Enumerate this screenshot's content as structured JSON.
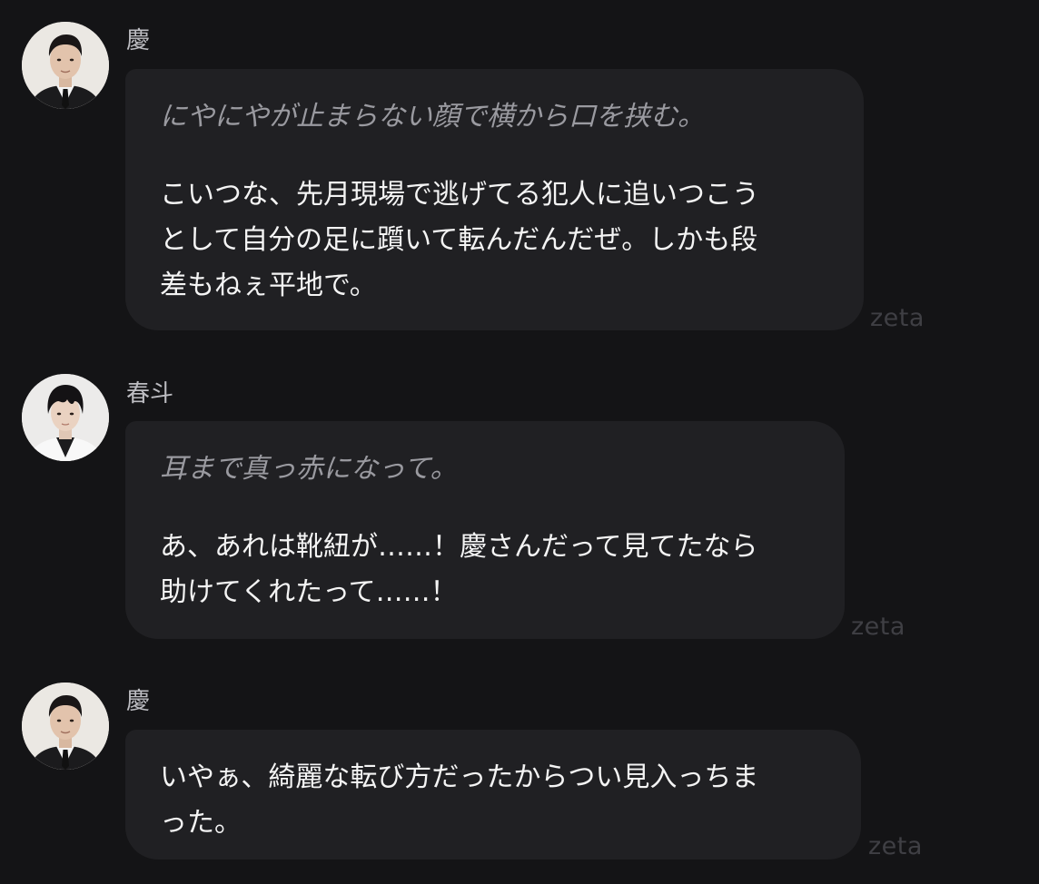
{
  "messages": [
    {
      "speaker": "慶",
      "avatar_icon": "man-in-suit-avatar",
      "narration": "にやにやが止まらない顔で横から口を挟む。",
      "speech": "こいつな、先月現場で逃げてる犯人に追いつこう\nとして自分の足に躓いて転んだんだぜ。しかも段\n差もねぇ平地で。",
      "brand": "zeta"
    },
    {
      "speaker": "春斗",
      "avatar_icon": "young-man-white-coat-avatar",
      "narration": "耳まで真っ赤になって。",
      "speech": "あ、あれは靴紐が……！慶さんだって見てたなら\n助けてくれたって……！",
      "brand": "zeta"
    },
    {
      "speaker": "慶",
      "avatar_icon": "man-in-suit-avatar",
      "narration": "",
      "speech": "いやぁ、綺麗な転び方だったからつい見入っちま\nった。",
      "brand": "zeta"
    }
  ],
  "colors": {
    "background": "#141416",
    "bubble": "#202023",
    "narration_text": "#9a9aa0",
    "speech_text": "#f4f4f4",
    "speaker_name": "#bdbdc2",
    "brand_text": "#3f3f44"
  }
}
